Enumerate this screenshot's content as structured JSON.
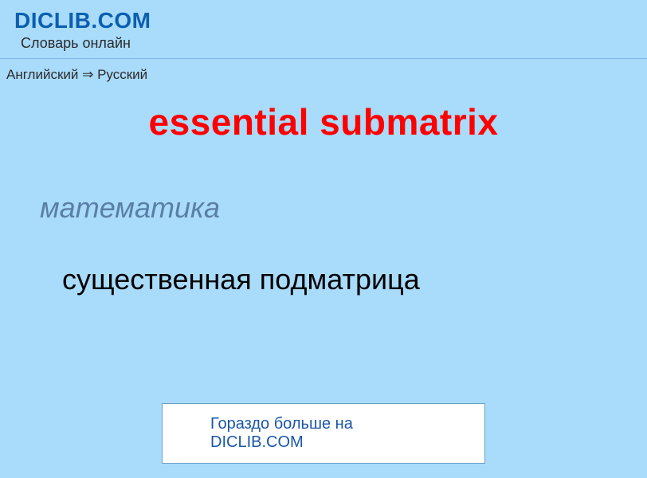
{
  "header": {
    "site_title": "DICLIB.COM",
    "subtitle": "Словарь онлайн"
  },
  "breadcrumb": {
    "text": "Английский ⇒ Русский"
  },
  "entry": {
    "title": "essential submatrix",
    "category": "математика",
    "translation": "существенная подматрица"
  },
  "footer": {
    "link_text": "Гораздо больше на DICLIB.COM"
  }
}
